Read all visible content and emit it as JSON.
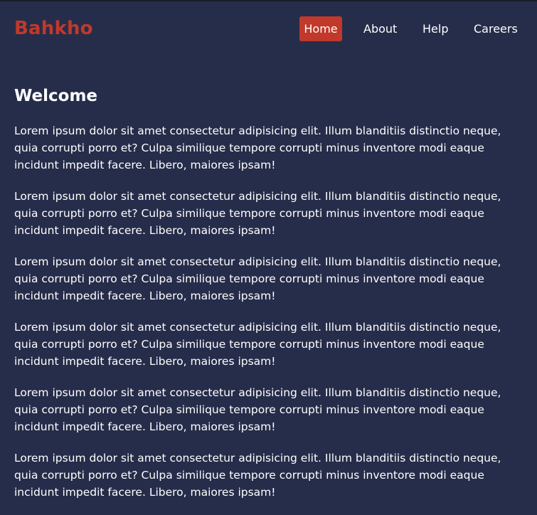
{
  "brand": {
    "name": "Bahkho",
    "accent_color": "#c0392b",
    "background_color": "#262d4a"
  },
  "nav": {
    "items": [
      {
        "label": "Home",
        "active": true
      },
      {
        "label": "About",
        "active": false
      },
      {
        "label": "Help",
        "active": false
      },
      {
        "label": "Careers",
        "active": false
      }
    ]
  },
  "main": {
    "title": "Welcome",
    "paragraphs": [
      "Lorem ipsum dolor sit amet consectetur adipisicing elit. Illum blanditiis distinctio neque, quia corrupti porro et? Culpa similique tempore corrupti minus inventore modi eaque incidunt impedit facere. Libero, maiores ipsam!",
      "Lorem ipsum dolor sit amet consectetur adipisicing elit. Illum blanditiis distinctio neque, quia corrupti porro et? Culpa similique tempore corrupti minus inventore modi eaque incidunt impedit facere. Libero, maiores ipsam!",
      "Lorem ipsum dolor sit amet consectetur adipisicing elit. Illum blanditiis distinctio neque, quia corrupti porro et? Culpa similique tempore corrupti minus inventore modi eaque incidunt impedit facere. Libero, maiores ipsam!",
      "Lorem ipsum dolor sit amet consectetur adipisicing elit. Illum blanditiis distinctio neque, quia corrupti porro et? Culpa similique tempore corrupti minus inventore modi eaque incidunt impedit facere. Libero, maiores ipsam!",
      "Lorem ipsum dolor sit amet consectetur adipisicing elit. Illum blanditiis distinctio neque, quia corrupti porro et? Culpa similique tempore corrupti minus inventore modi eaque incidunt impedit facere. Libero, maiores ipsam!",
      "Lorem ipsum dolor sit amet consectetur adipisicing elit. Illum blanditiis distinctio neque, quia corrupti porro et? Culpa similique tempore corrupti minus inventore modi eaque incidunt impedit facere. Libero, maiores ipsam!"
    ]
  }
}
